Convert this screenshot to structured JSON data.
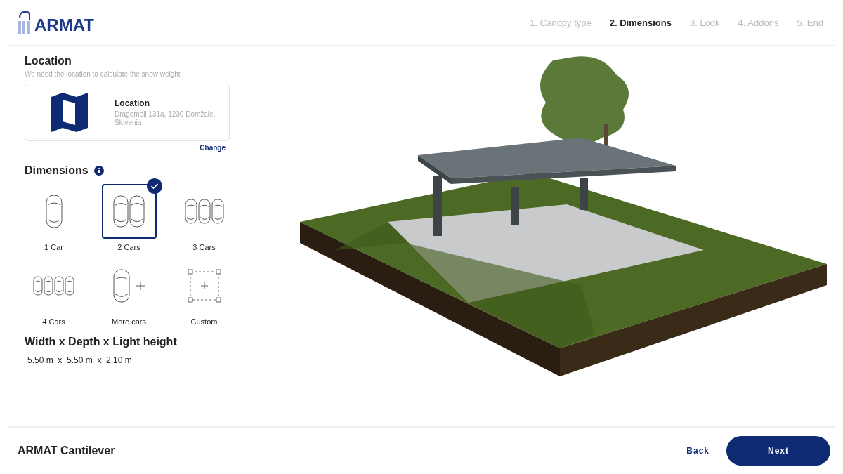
{
  "logo": {
    "text": "ARMAT"
  },
  "steps": [
    {
      "label": "1. Canopy type",
      "selected": false
    },
    {
      "label": "2. Dimensions",
      "selected": true
    },
    {
      "label": "3. Look",
      "selected": false
    },
    {
      "label": "4. Addons",
      "selected": false
    },
    {
      "label": "5. End",
      "selected": false
    }
  ],
  "location": {
    "title": "Location",
    "hint": "We need the location to calculate the snow weight",
    "card_title": "Location",
    "address": "Dragomelj 131a, 1230 Domžale, Slovenia",
    "change": "Change"
  },
  "dimensions": {
    "title": "Dimensions",
    "options": [
      {
        "label": "1 Car",
        "kind": "one",
        "selected": false
      },
      {
        "label": "2 Cars",
        "kind": "two",
        "selected": true
      },
      {
        "label": "3 Cars",
        "kind": "three",
        "selected": false
      },
      {
        "label": "4 Cars",
        "kind": "four",
        "selected": false
      },
      {
        "label": "More cars",
        "kind": "more",
        "selected": false
      },
      {
        "label": "Custom",
        "kind": "custom",
        "selected": false
      }
    ]
  },
  "size": {
    "title": "Width x Depth x Light height",
    "value": "5.50 m  x  5.50 m  x  2.10 m"
  },
  "footer": {
    "product": "ARMAT Cantilever",
    "back": "Back",
    "next": "Next"
  }
}
